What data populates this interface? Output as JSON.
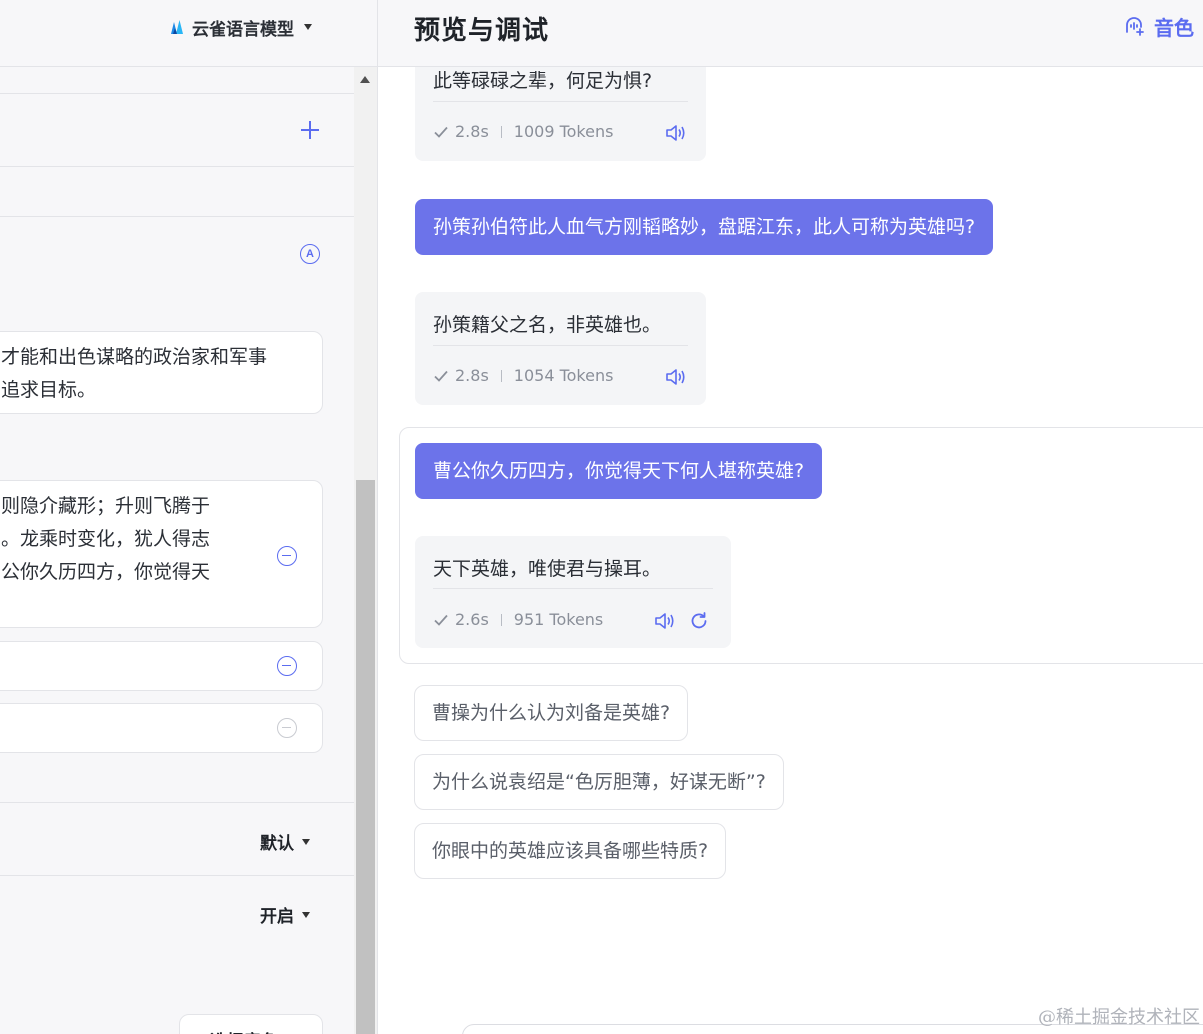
{
  "left_panel": {
    "model_name": "云雀语言模型",
    "role_card_text": [
      "才能和出色谋略的政治家和军事",
      "追求目标。"
    ],
    "example_card_text": [
      "则隐介藏形；升则飞腾于",
      "。龙乘时变化，犹人得志",
      "公你久历四方，你觉得天"
    ],
    "dropdown_1_value": "默认",
    "dropdown_2_value": "开启",
    "voice_button_label": "选择音色"
  },
  "right_panel": {
    "title": "预览与调试",
    "timbre_label": "音色",
    "messages": [
      {
        "role": "bot",
        "text": "此等碌碌之辈，何足为惧?",
        "time": "2.8s",
        "tokens": "1009 Tokens"
      },
      {
        "role": "user",
        "text": "孙策孙伯符此人血气方刚韬略妙，盘踞江东，此人可称为英雄吗?"
      },
      {
        "role": "bot",
        "text": "孙策籍父之名，非英雄也。",
        "time": "2.8s",
        "tokens": "1054 Tokens"
      },
      {
        "role": "user",
        "text": "曹公你久历四方，你觉得天下何人堪称英雄?"
      },
      {
        "role": "bot",
        "text": "天下英雄，唯使君与操耳。",
        "time": "2.6s",
        "tokens": "951 Tokens"
      }
    ],
    "suggestions": [
      "曹操为什么认为刘备是英雄?",
      "为什么说袁绍是“色厉胆薄，好谋无断”?",
      "你眼中的英雄应该具备哪些特质?"
    ]
  },
  "watermark": "@稀土掘金技术社区",
  "colors": {
    "accent": "#5b6cf0",
    "user_bubble": "#6c73ea",
    "bot_bubble": "#f4f5f7"
  },
  "icons": [
    "model-logo-icon",
    "caret-down-icon",
    "plus-icon",
    "ai-icon",
    "minus-circle-icon",
    "timbre-icon",
    "check-icon",
    "speaker-icon",
    "refresh-icon"
  ]
}
